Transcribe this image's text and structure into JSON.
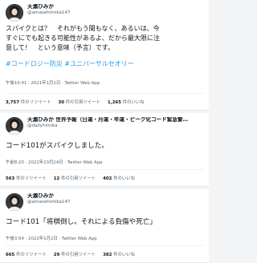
{
  "tweets": [
    {
      "display_name": "天瀬ひみか",
      "handle": "@amasehimika147",
      "text_lines": [
        "スパイクとは？　それがもう間もなく、あるいは、今",
        "すぐにでも起きる可能性があるよ、だから最大限に注",
        "意して！　という意味（予言）です。"
      ],
      "hashtags": "#コードロジー防災 #ユニバーサルセオリー",
      "meta": "午後10:41 · 2021年1月1日 · Twitter Web App",
      "retweets_count": "3,757",
      "retweets_label": "件のリツイート",
      "quotes_count": "30",
      "quotes_label": "件の引用ツイート",
      "likes_count": "1,265",
      "likes_label": "件のいいね"
    },
    {
      "display_name": "天瀬ひみか 世界予報（日運・月運・年運・ピーク化コード緊急警…",
      "handle": "@dailyhimika",
      "text": "コード101がスパイクしました。",
      "meta": "午前8:20 · 2022年10月24日 · Twitter Web App",
      "retweets_count": "563",
      "retweets_label": "件のリツイート",
      "quotes_count": "12",
      "quotes_label": "件の引用ツイート",
      "likes_count": "402",
      "likes_label": "件のいいね"
    },
    {
      "display_name": "天瀬ひみか",
      "handle": "@amasehimika147",
      "text": "コード101「将棋倒し。それによる負傷や死亡」",
      "meta": "午後3:54 · 2022年1月2日 · Twitter Web App",
      "retweets_count": "665",
      "retweets_label": "件のリツイート",
      "quotes_count": "29",
      "quotes_label": "件の引用ツイート",
      "likes_count": "382",
      "likes_label": "件のいいね"
    }
  ],
  "colors": {
    "hashtag": "#1d9bf0",
    "text": "#0f1419",
    "secondary": "#536471"
  }
}
